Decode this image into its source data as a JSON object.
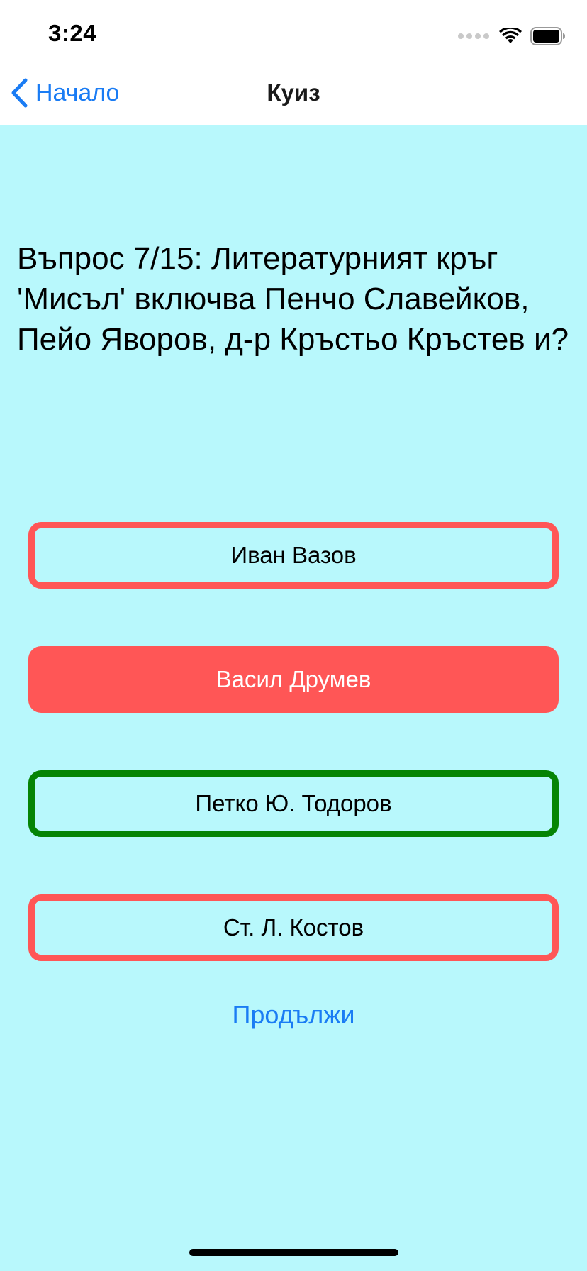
{
  "status_bar": {
    "time": "3:24"
  },
  "nav": {
    "back_label": "Начало",
    "title": "Куиз"
  },
  "question": {
    "text": "Въпрос 7/15: Литературният кръг 'Мисъл' включва Пенчо Славейков, Пейо Яворов, д-р Кръстьо Кръстев и?"
  },
  "answers": [
    {
      "label": "Иван Вазов",
      "state": "incorrect-outline"
    },
    {
      "label": "Васил Друмев",
      "state": "selected-wrong"
    },
    {
      "label": "Петко Ю. Тодоров",
      "state": "correct"
    },
    {
      "label": "Ст. Л. Костов",
      "state": "incorrect-outline"
    }
  ],
  "continue_label": "Продължи",
  "colors": {
    "background": "#b8f8fc",
    "accent": "#1a7cf4",
    "wrong": "#ff5656",
    "correct": "#058405"
  },
  "icons": [
    "chevron-left-icon",
    "cellular-signal-icon",
    "wifi-icon",
    "battery-icon"
  ]
}
